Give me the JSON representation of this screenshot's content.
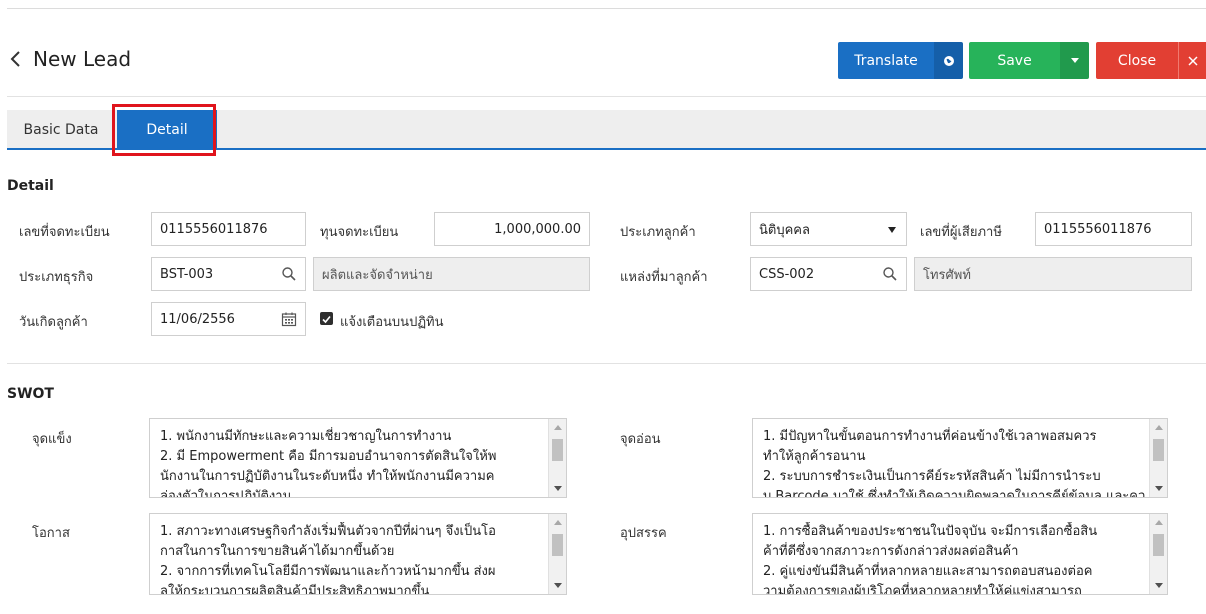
{
  "header": {
    "title": "New Lead",
    "translate_label": "Translate",
    "save_label": "Save",
    "close_label": "Close"
  },
  "tabs": [
    {
      "label": "Basic Data",
      "active": false
    },
    {
      "label": "Detail",
      "active": true
    }
  ],
  "detail": {
    "section_title": "Detail",
    "registration_no": {
      "label": "เลขที่จดทะเบียน",
      "value": "0115556011876"
    },
    "registered_capital": {
      "label": "ทุนจดทะเบียน",
      "value": "1,000,000.00"
    },
    "customer_type": {
      "label": "ประเภทลูกค้า",
      "value": "นิติบุคคล"
    },
    "tax_id": {
      "label": "เลขที่ผู้เสียภาษี",
      "value": "0115556011876"
    },
    "business_type": {
      "label": "ประเภทธุรกิจ",
      "code": "BST-003",
      "description": "ผลิตและจัดจำหน่าย"
    },
    "customer_source": {
      "label": "แหล่งที่มาลูกค้า",
      "code": "CSS-002",
      "description": "โทรศัพท์"
    },
    "customer_birthday": {
      "label": "วันเกิดลูกค้า",
      "value": "11/06/2556"
    },
    "calendar_reminder": {
      "label": "แจ้งเตือนบนปฏิทิน",
      "checked": true
    }
  },
  "swot": {
    "section_title": "SWOT",
    "strengths": {
      "label": "จุดแข็ง",
      "lines": [
        "1. พนักงานมีทักษะและความเชี่ยวชาญในการทำงาน",
        "2. มี Empowerment คือ มีการมอบอำนาจการตัดสินใจให้พ",
        "นักงานในการปฏิบัติงานในระดับหนึ่ง ทำให้พนักงานมีความค",
        "ล่องตัวในการปฏิบัติงาน"
      ]
    },
    "weaknesses": {
      "label": "จุดอ่อน",
      "lines": [
        "1. มีปัญหาในขั้นตอนการทำงานที่ค่อนข้างใช้เวลาพอสมควร",
        " ทำให้ลูกค้ารอนาน",
        "2. ระบบการชำระเงินเป็นการคีย์ระรหัสสินค้า ไม่มีการนำระบ",
        "บ Barcode มาใช้ ซึ่งทำให้เกิดความผิดพลาดในการคีย์ข้อมูล และความ"
      ]
    },
    "opportunities": {
      "label": "โอกาส",
      "lines": [
        "1. สภาวะทางเศรษฐกิจกำลังเริ่มฟื้นตัวจากปีที่ผ่านๆ จึงเป็นโอ",
        "กาสในการในการขายสินค้าได้มากขึ้นด้วย",
        "2. จากการที่เทคโนโลยีมีการพัฒนาและก้าวหน้ามากขึ้น ส่งผ",
        "ลให้กระบวนการผลิตสินค้ามีประสิทธิภาพมากขึ้น"
      ]
    },
    "threats": {
      "label": "อุปสรรค",
      "lines": [
        "1. การซื้อสินค้าของประชาชนในปัจจุบัน จะมีการเลือกซื้อสิน",
        "ค้าที่ดีซึ่งจากสภาวะการดังกล่าวส่งผลต่อสินค้า",
        "2. คู่แข่งขันมีสินค้าที่หลากหลายและสามารถตอบสนองต่อค",
        "วามต้องการของผู้บริโภคที่หลากหลายทำให้คู่แข่งสามารถ"
      ]
    }
  },
  "colors": {
    "primary_blue": "#1a6fc4",
    "save_green": "#27b35a",
    "close_red": "#e23f33",
    "highlight_red": "#e0141c"
  }
}
